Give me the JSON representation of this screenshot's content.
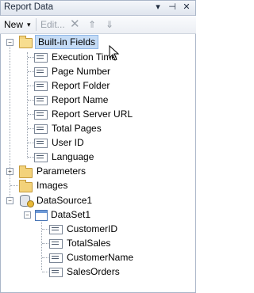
{
  "window": {
    "title": "Report Data",
    "pin_glyph": "▾",
    "autohide_glyph": "⊣",
    "close_glyph": "✕"
  },
  "toolbar": {
    "new_label": "New",
    "new_arrow": "▾",
    "edit_label": "Edit...",
    "delete_glyph": "✕",
    "up_glyph": "⇑",
    "down_glyph": "⇓"
  },
  "tree": {
    "builtin": {
      "label": "Built-in Fields",
      "expander": "−",
      "items": [
        "Execution Time",
        "Page Number",
        "Report Folder",
        "Report Name",
        "Report Server URL",
        "Total Pages",
        "User ID",
        "Language"
      ]
    },
    "parameters": {
      "label": "Parameters",
      "expander": "+"
    },
    "images": {
      "label": "Images"
    },
    "datasource": {
      "label": "DataSource1",
      "expander": "−",
      "dataset": {
        "label": "DataSet1",
        "expander": "−",
        "fields": [
          "CustomerID",
          "TotalSales",
          "CustomerName",
          "SalesOrders"
        ]
      }
    }
  }
}
